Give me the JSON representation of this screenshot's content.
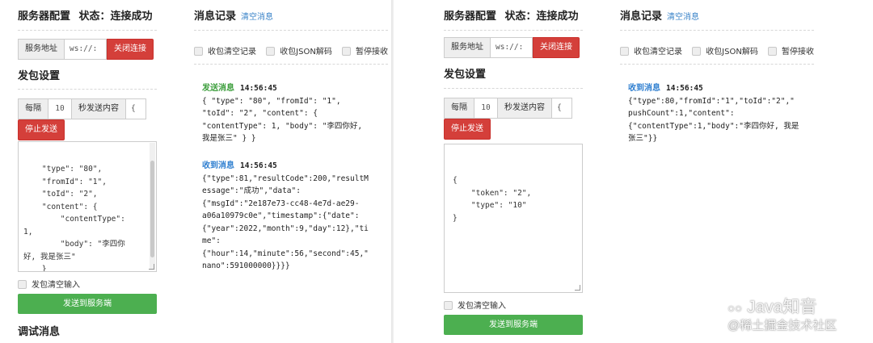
{
  "left": {
    "config_title": "服务器配置",
    "status_label": "状态：连接成功",
    "address_label": "服务地址",
    "address_value": "ws://:",
    "disconnect_btn": "关闭连接",
    "send_settings_title": "发包设置",
    "interval_label": "每隔",
    "interval_value": "10",
    "interval_unit_label": "秒发送内容",
    "interval_content_value": "{",
    "stop_btn": "停止发送",
    "textarea_lines": [
      "    \"type\": \"80\",",
      "    \"fromId\": \"1\",",
      "    \"toId\": \"2\",",
      "    \"content\": {",
      "        \"contentType\":",
      "1,",
      "        \"body\": \"李四你",
      "好, 我是张三\"",
      "    }",
      "}"
    ],
    "clear_input_label": "发包清空输入",
    "send_btn": "发送到服务端",
    "debug_title": "调试消息",
    "log_title": "消息记录",
    "clear_log_link": "清空消息",
    "checkboxes": [
      "收包清空记录",
      "收包JSON解码",
      "暂停接收"
    ],
    "messages": [
      {
        "tag": "发送消息",
        "time": "14:56:45",
        "lines": [
          "{ \"type\": \"80\", \"fromId\": \"1\",",
          "\"toId\": \"2\", \"content\": {",
          "\"contentType\": 1, \"body\": \"李四你好,",
          "我是张三\" } }"
        ]
      },
      {
        "tag": "收到消息",
        "time": "14:56:45",
        "lines": [
          "{\"type\":81,\"resultCode\":200,\"resultM",
          "essage\":\"成功\",\"data\":",
          "{\"msgId\":\"2e187e73-cc48-4e7d-ae29-",
          "a06a10979c0e\",\"timestamp\":{\"date\":",
          "{\"year\":2022,\"month\":9,\"day\":12},\"ti",
          "me\":",
          "{\"hour\":14,\"minute\":56,\"second\":45,\"",
          "nano\":591000000}}}}"
        ]
      }
    ]
  },
  "right": {
    "config_title": "服务器配置",
    "status_label": "状态：连接成功",
    "address_label": "服务地址",
    "address_value": "ws://:",
    "disconnect_btn": "关闭连接",
    "send_settings_title": "发包设置",
    "interval_label": "每隔",
    "interval_value": "10",
    "interval_unit_label": "秒发送内容",
    "interval_content_value": "{",
    "stop_btn": "停止发送",
    "textarea_lines": [
      "{",
      "    \"token\": \"2\",",
      "    \"type\": \"10\"",
      "}"
    ],
    "clear_input_label": "发包清空输入",
    "send_btn": "发送到服务端",
    "log_title": "消息记录",
    "clear_log_link": "清空消息",
    "checkboxes": [
      "收包清空记录",
      "收包JSON解码",
      "暂停接收"
    ],
    "messages": [
      {
        "tag": "收到消息",
        "time": "14:56:45",
        "lines": [
          "{\"type\":80,\"fromId\":\"1\",\"toId\":\"2\",\"",
          "pushCount\":1,\"content\":",
          "{\"contentType\":1,\"body\":\"李四你好, 我是",
          "张三\"}}"
        ]
      }
    ]
  },
  "watermark": {
    "line1": "Java知音",
    "line2": "@稀土掘金技术社区"
  }
}
